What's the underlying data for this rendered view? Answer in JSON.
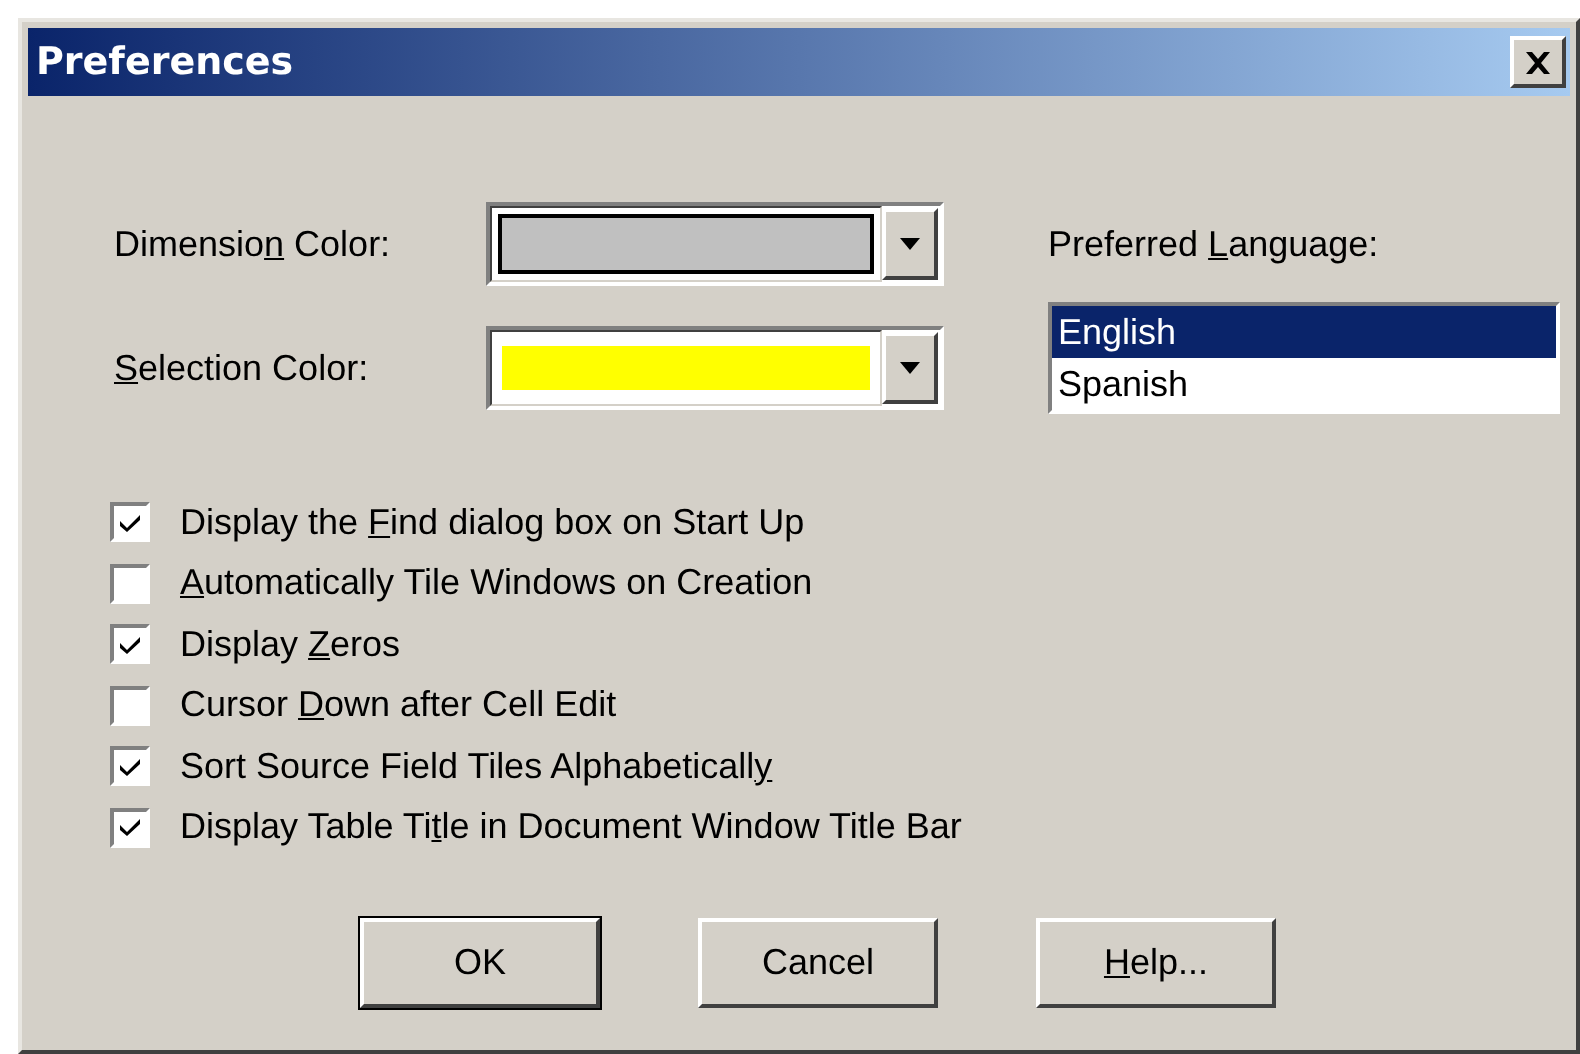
{
  "window": {
    "title": "Preferences"
  },
  "color_fields": [
    {
      "label": {
        "before": "Dimensio",
        "key": "n",
        "after": " Color:"
      },
      "color": "#c0c0c0",
      "focused": true
    },
    {
      "label": {
        "key": "S",
        "after": "election Color:"
      },
      "color": "#ffff00",
      "focused": false
    }
  ],
  "language": {
    "label": {
      "before": "Preferred ",
      "key": "L",
      "after": "anguage:"
    },
    "items": [
      {
        "text": "English",
        "selected": true
      },
      {
        "text": "Spanish",
        "selected": false
      }
    ]
  },
  "options": [
    {
      "label": {
        "before": "Display the ",
        "key": "F",
        "after": "ind dialog box on Start Up"
      },
      "checked": true
    },
    {
      "label": {
        "key": "A",
        "after": "utomatically Tile Windows on Creation"
      },
      "checked": false
    },
    {
      "label": {
        "before": "Display ",
        "key": "Z",
        "after": "eros"
      },
      "checked": true
    },
    {
      "label": {
        "before": "Cursor ",
        "key": "D",
        "after": "own after Cell Edit"
      },
      "checked": false
    },
    {
      "label": {
        "before": "Sort Source Field Tiles Alphabeticall",
        "key": "y"
      },
      "checked": true
    },
    {
      "label": {
        "before": "Display Table Ti",
        "key": "t",
        "after": "le in Document Window Title Bar"
      },
      "checked": true
    }
  ],
  "buttons": [
    {
      "label": {
        "before": "OK"
      },
      "default": true
    },
    {
      "label": {
        "before": "Cancel"
      },
      "default": false
    },
    {
      "label": {
        "key": "H",
        "after": "elp..."
      },
      "default": false
    }
  ]
}
